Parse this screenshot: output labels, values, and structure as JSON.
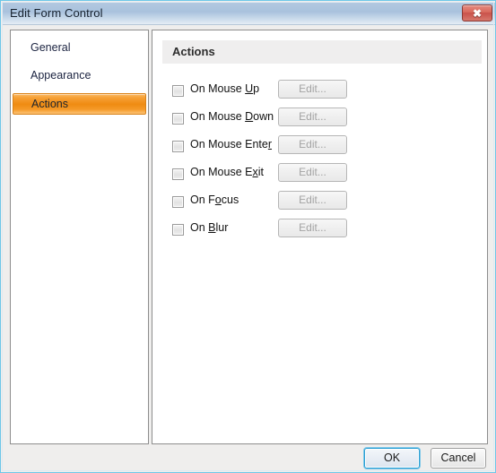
{
  "window": {
    "title": "Edit Form Control",
    "close_icon": "close-icon",
    "close_glyph": "✖",
    "accent_blue": "#6ec7e8",
    "titlebar_gradient_top": "#b2c8e0",
    "titlebar_gradient_bottom": "#e6eef6",
    "body_background": "#efeeed"
  },
  "sidebar": {
    "items": [
      {
        "label": "General",
        "selected": false
      },
      {
        "label": "Appearance",
        "selected": false
      },
      {
        "label": "Actions",
        "selected": true
      }
    ],
    "selected_gradient_top": "#fbbd6a",
    "selected_gradient_mid": "#ef8b12",
    "selected_gradient_bottom": "#fcc376"
  },
  "main": {
    "section_title": "Actions",
    "section_header_background": "#efeeee",
    "rows": [
      {
        "label_prefix": "On Mouse ",
        "accel": "U",
        "label_suffix": "p",
        "checked": false,
        "button_label": "Edit...",
        "button_enabled": false
      },
      {
        "label_prefix": "On Mouse ",
        "accel": "D",
        "label_suffix": "own",
        "checked": false,
        "button_label": "Edit...",
        "button_enabled": false
      },
      {
        "label_prefix": "On Mouse Ente",
        "accel": "r",
        "label_suffix": "",
        "checked": false,
        "button_label": "Edit...",
        "button_enabled": false
      },
      {
        "label_prefix": "On Mouse E",
        "accel": "x",
        "label_suffix": "it",
        "checked": false,
        "button_label": "Edit...",
        "button_enabled": false
      },
      {
        "label_prefix": "On F",
        "accel": "o",
        "label_suffix": "cus",
        "checked": false,
        "button_label": "Edit...",
        "button_enabled": false
      },
      {
        "label_prefix": "On ",
        "accel": "B",
        "label_suffix": "lur",
        "checked": false,
        "button_label": "Edit...",
        "button_enabled": false
      }
    ]
  },
  "footer": {
    "ok_label": "OK",
    "cancel_label": "Cancel",
    "ok_is_default": true
  }
}
